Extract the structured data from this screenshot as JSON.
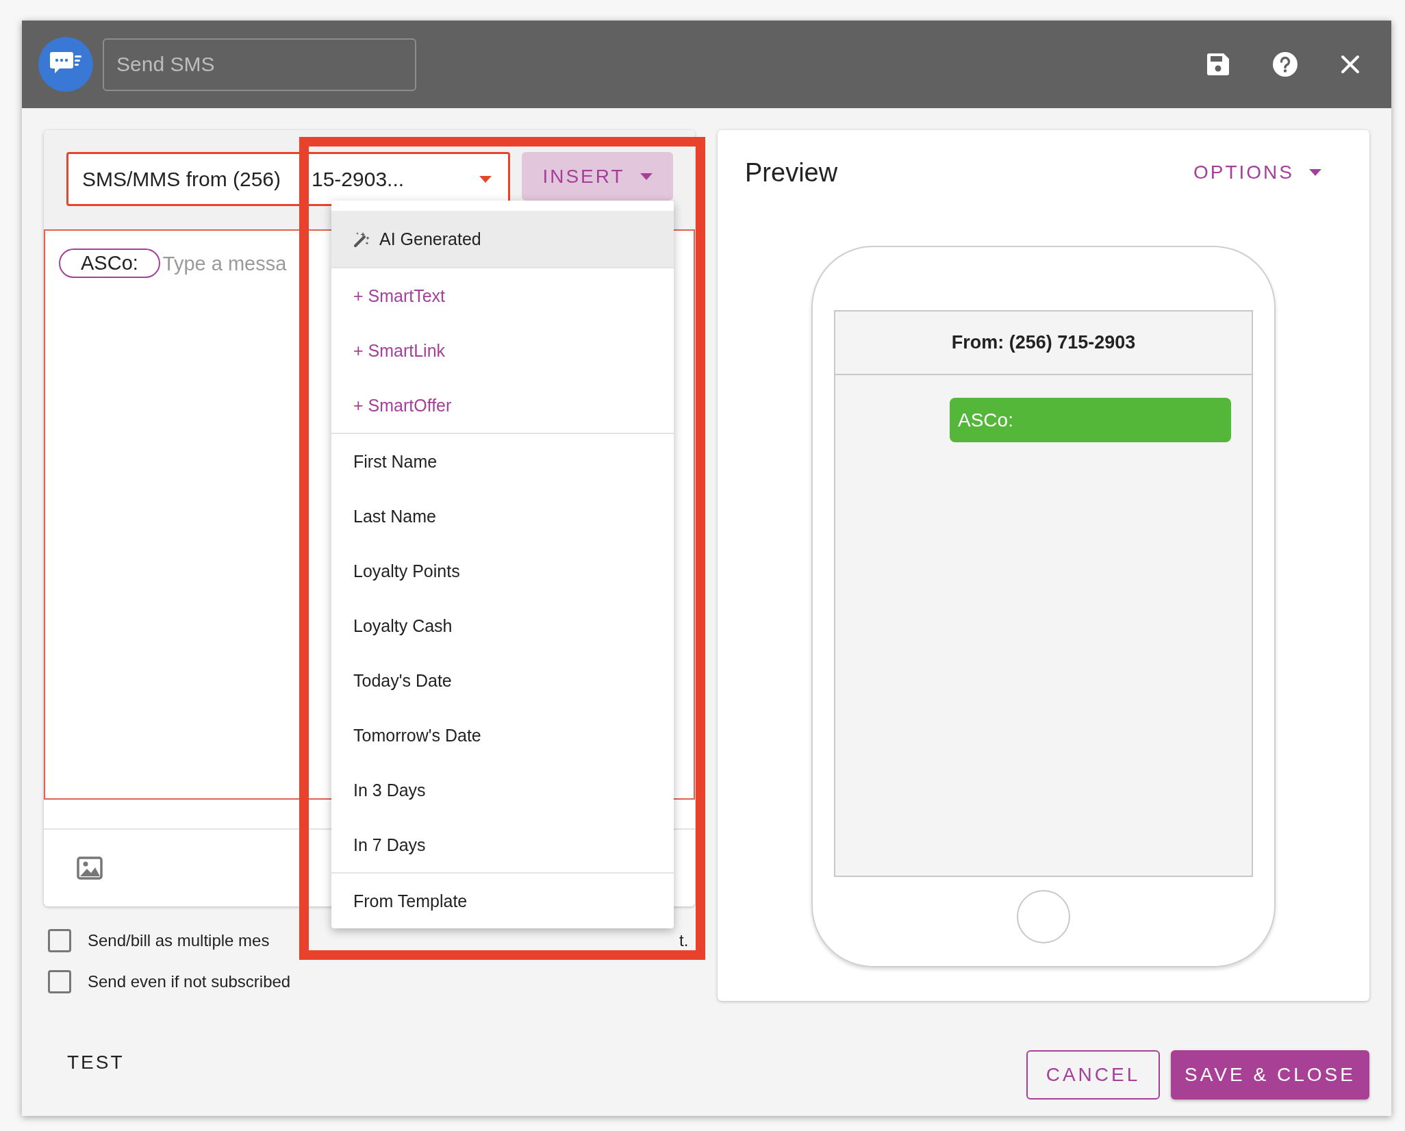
{
  "title_field": {
    "placeholder": "Send SMS"
  },
  "composer": {
    "sender": "SMS/MMS from (256)",
    "sender_tail": "15-2903...",
    "insert_button": "INSERT",
    "chip": "ASCo:",
    "message_placeholder": "Type a messa"
  },
  "insert_menu": {
    "sections": [
      [
        {
          "label": "AI Generated",
          "kind": "ai",
          "selected": true
        }
      ],
      [
        {
          "label": "+ SmartText",
          "kind": "smart",
          "selected": false
        },
        {
          "label": "+ SmartLink",
          "kind": "smart",
          "selected": false
        },
        {
          "label": "+ SmartOffer",
          "kind": "smart",
          "selected": false
        }
      ],
      [
        {
          "label": "First Name",
          "kind": "field",
          "selected": false
        },
        {
          "label": "Last Name",
          "kind": "field",
          "selected": false
        },
        {
          "label": "Loyalty Points",
          "kind": "field",
          "selected": false
        },
        {
          "label": "Loyalty Cash",
          "kind": "field",
          "selected": false
        },
        {
          "label": "Today's Date",
          "kind": "field",
          "selected": false
        },
        {
          "label": "Tomorrow's Date",
          "kind": "field",
          "selected": false
        },
        {
          "label": "In 3 Days",
          "kind": "field",
          "selected": false
        },
        {
          "label": "In 7 Days",
          "kind": "field",
          "selected": false
        }
      ],
      [
        {
          "label": "From Template",
          "kind": "field",
          "selected": false
        }
      ]
    ]
  },
  "annotation": {
    "kind": "highlight-frame"
  },
  "options": [
    {
      "label": "Send/bill as multiple mes",
      "label_tail": "t.",
      "checked": false
    },
    {
      "label": "Send even if not subscribed",
      "checked": false
    }
  ],
  "test_link": "TEST",
  "preview": {
    "title": "Preview",
    "options_button": "OPTIONS",
    "from": "From: (256) 715-2903",
    "bubble": "ASCo:"
  },
  "buttons": [
    {
      "label": "CANCEL",
      "kind": "secondary"
    },
    {
      "label": "SAVE & CLOSE",
      "kind": "primary"
    }
  ]
}
